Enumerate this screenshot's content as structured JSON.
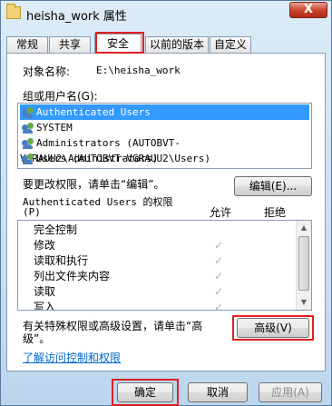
{
  "window": {
    "title": "heisha_work 属性",
    "close": "X"
  },
  "tabs": [
    "常规",
    "共享",
    "安全",
    "以前的版本",
    "自定义"
  ],
  "security": {
    "object_label": "对象名称:",
    "object_value": "E:\\heisha_work",
    "group_label": "组或用户名(G):",
    "users": [
      "Authenticated Users",
      "SYSTEM",
      "Administrators (AUTOBVT-VGRAUU2\\Administrators)",
      "Users (AUTOBVT-VGRAUU2\\Users)"
    ],
    "change_hint": "要更改权限，请单击“编辑”。",
    "edit_button": "编辑(E)...",
    "perm_for": "Authenticated Users 的权限",
    "perm_key": "(P)",
    "allow_col": "允许",
    "deny_col": "拒绝",
    "permissions": [
      {
        "name": "完全控制",
        "allow": ""
      },
      {
        "name": "修改",
        "allow": "✓"
      },
      {
        "name": "读取和执行",
        "allow": "✓"
      },
      {
        "name": "列出文件夹内容",
        "allow": "✓"
      },
      {
        "name": "读取",
        "allow": "✓"
      },
      {
        "name": "写入",
        "allow": "✓"
      }
    ],
    "special_hint_1": "有关特殊权限或高级设置，请单击“高",
    "special_hint_2": "级”。",
    "advanced_button": "高级(V)",
    "learn_link": "了解访问控制和权限"
  },
  "footer": {
    "ok": "确定",
    "cancel": "取消",
    "apply": "应用(A)"
  },
  "colors": {
    "highlight": "#e02020",
    "selection": "#3399ff"
  }
}
